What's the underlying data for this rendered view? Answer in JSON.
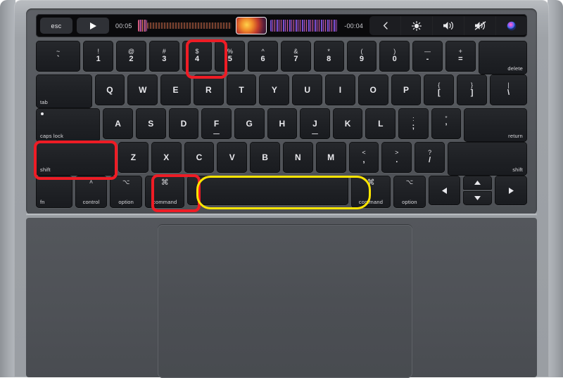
{
  "device": {
    "name": "macbook-pro-keyboard",
    "colors": {
      "highlight_red": "#ee1c25",
      "highlight_yellow": "#ffe500",
      "key_face": "#1e2024",
      "deck": "#54575c",
      "touchbar": "#0a0a0c",
      "body": "#a9adb2",
      "page_background": "#ffffff"
    }
  },
  "touchbar": {
    "esc_label": "esc",
    "play_icon": "play-icon",
    "elapsed_time": "00:05",
    "remaining_time": "-00:04",
    "waveform_left": "audio-waveform",
    "artwork_thumbnail": "album-art-thumbnail",
    "waveform_right": "audio-waveform",
    "controls": [
      {
        "icon": "chevron-left-icon",
        "label": ""
      },
      {
        "icon": "brightness-icon",
        "label": ""
      },
      {
        "icon": "volume-up-icon",
        "label": ""
      },
      {
        "icon": "volume-mute-icon",
        "label": ""
      },
      {
        "icon": "siri-icon",
        "label": ""
      }
    ]
  },
  "highlights": [
    {
      "target": "key-4",
      "color": "red",
      "style": "box"
    },
    {
      "target": "key-shift-left",
      "color": "red",
      "style": "box"
    },
    {
      "target": "key-command-left",
      "color": "red",
      "style": "box"
    },
    {
      "target": "key-space",
      "color": "yellow",
      "style": "pill"
    }
  ],
  "rows": {
    "number_row": [
      {
        "name": "grave",
        "top": "~",
        "bottom": "`",
        "width": 1.48,
        "type": "dual"
      },
      {
        "name": "1",
        "top": "!",
        "bottom": "1",
        "width": 1,
        "type": "dual"
      },
      {
        "name": "2",
        "top": "@",
        "bottom": "2",
        "width": 1,
        "type": "dual"
      },
      {
        "name": "3",
        "top": "#",
        "bottom": "3",
        "width": 1,
        "type": "dual"
      },
      {
        "name": "4",
        "top": "$",
        "bottom": "4",
        "width": 1,
        "type": "dual"
      },
      {
        "name": "5",
        "top": "%",
        "bottom": "5",
        "width": 1,
        "type": "dual"
      },
      {
        "name": "6",
        "top": "^",
        "bottom": "6",
        "width": 1,
        "type": "dual"
      },
      {
        "name": "7",
        "top": "&",
        "bottom": "7",
        "width": 1,
        "type": "dual"
      },
      {
        "name": "8",
        "top": "*",
        "bottom": "8",
        "width": 1,
        "type": "dual"
      },
      {
        "name": "9",
        "top": "(",
        "bottom": "9",
        "width": 1,
        "type": "dual"
      },
      {
        "name": "0",
        "top": ")",
        "bottom": "0",
        "width": 1,
        "type": "dual"
      },
      {
        "name": "minus",
        "top": "—",
        "bottom": "-",
        "width": 1,
        "type": "dual"
      },
      {
        "name": "equal",
        "top": "+",
        "bottom": "=",
        "width": 1,
        "type": "dual"
      },
      {
        "name": "delete",
        "label": "delete",
        "width": 1.48,
        "type": "mod-right"
      }
    ],
    "top_letter_row": [
      {
        "name": "tab",
        "label": "tab",
        "width": 1.72,
        "type": "mod-left"
      },
      {
        "name": "Q",
        "bottom": "Q",
        "width": 1,
        "type": "single"
      },
      {
        "name": "W",
        "bottom": "W",
        "width": 1,
        "type": "single"
      },
      {
        "name": "E",
        "bottom": "E",
        "width": 1,
        "type": "single"
      },
      {
        "name": "R",
        "bottom": "R",
        "width": 1,
        "type": "single"
      },
      {
        "name": "T",
        "bottom": "T",
        "width": 1,
        "type": "single"
      },
      {
        "name": "Y",
        "bottom": "Y",
        "width": 1,
        "type": "single"
      },
      {
        "name": "U",
        "bottom": "U",
        "width": 1,
        "type": "single"
      },
      {
        "name": "I",
        "bottom": "I",
        "width": 1,
        "type": "single"
      },
      {
        "name": "O",
        "bottom": "O",
        "width": 1,
        "type": "single"
      },
      {
        "name": "P",
        "bottom": "P",
        "width": 1,
        "type": "single"
      },
      {
        "name": "bracket-left",
        "top": "{",
        "bottom": "[",
        "width": 1,
        "type": "dual"
      },
      {
        "name": "bracket-right",
        "top": "}",
        "bottom": "]",
        "width": 1,
        "type": "dual"
      },
      {
        "name": "backslash",
        "top": "|",
        "bottom": "\\",
        "width": 1.24,
        "type": "dual"
      }
    ],
    "home_row": [
      {
        "name": "caps-lock",
        "label": "caps lock",
        "width": 2.0,
        "type": "caps"
      },
      {
        "name": "A",
        "bottom": "A",
        "width": 1,
        "type": "single"
      },
      {
        "name": "S",
        "bottom": "S",
        "width": 1,
        "type": "single"
      },
      {
        "name": "D",
        "bottom": "D",
        "width": 1,
        "type": "single"
      },
      {
        "name": "F",
        "bottom": "F",
        "width": 1,
        "type": "single",
        "homing": true
      },
      {
        "name": "G",
        "bottom": "G",
        "width": 1,
        "type": "single"
      },
      {
        "name": "H",
        "bottom": "H",
        "width": 1,
        "type": "single"
      },
      {
        "name": "J",
        "bottom": "J",
        "width": 1,
        "type": "single",
        "homing": true
      },
      {
        "name": "K",
        "bottom": "K",
        "width": 1,
        "type": "single"
      },
      {
        "name": "L",
        "bottom": "L",
        "width": 1,
        "type": "single"
      },
      {
        "name": "semicolon",
        "top": ":",
        "bottom": ";",
        "width": 1,
        "type": "dual"
      },
      {
        "name": "quote",
        "top": "”",
        "bottom": "’",
        "width": 1,
        "type": "dual"
      },
      {
        "name": "return",
        "label": "return",
        "width": 1.96,
        "type": "mod-right"
      }
    ],
    "bottom_letter_row": [
      {
        "name": "shift-left",
        "label": "shift",
        "width": 2.5,
        "type": "mod-left"
      },
      {
        "name": "Z",
        "bottom": "Z",
        "width": 1,
        "type": "single"
      },
      {
        "name": "X",
        "bottom": "X",
        "width": 1,
        "type": "single"
      },
      {
        "name": "C",
        "bottom": "C",
        "width": 1,
        "type": "single"
      },
      {
        "name": "V",
        "bottom": "V",
        "width": 1,
        "type": "single"
      },
      {
        "name": "B",
        "bottom": "B",
        "width": 1,
        "type": "single"
      },
      {
        "name": "N",
        "bottom": "N",
        "width": 1,
        "type": "single"
      },
      {
        "name": "M",
        "bottom": "M",
        "width": 1,
        "type": "single"
      },
      {
        "name": "comma",
        "top": "<",
        "bottom": ",",
        "width": 1,
        "type": "dual"
      },
      {
        "name": "period",
        "top": ">",
        "bottom": ".",
        "width": 1,
        "type": "dual"
      },
      {
        "name": "slash",
        "top": "?",
        "bottom": "/",
        "width": 1,
        "type": "dual"
      },
      {
        "name": "shift-right",
        "label": "shift",
        "width": 2.5,
        "type": "mod-right"
      }
    ],
    "modifier_row": [
      {
        "name": "fn",
        "label": "fn",
        "width": 1.12,
        "type": "mod-left"
      },
      {
        "name": "control-left",
        "label": "control",
        "width": 1.12,
        "type": "mod-left",
        "glyph": "˄"
      },
      {
        "name": "option-left",
        "label": "option",
        "width": 1.12,
        "type": "mod-left",
        "glyph": "⌥"
      },
      {
        "name": "command-left",
        "label": "command",
        "width": 1.38,
        "type": "mod-left",
        "glyph": "⌘"
      },
      {
        "name": "space",
        "label": "",
        "width": 5.6,
        "type": "space"
      },
      {
        "name": "command-right",
        "label": "command",
        "width": 1.38,
        "type": "mod-left",
        "glyph": "⌘"
      },
      {
        "name": "option-right",
        "label": "option",
        "width": 1.12,
        "type": "mod-left",
        "glyph": "⌥"
      },
      {
        "name": "arrow-left",
        "label": "",
        "width": 1.12,
        "type": "arrow-left"
      },
      {
        "name": "arrow-up-down",
        "label": "",
        "width": 1.12,
        "type": "arrow-updown"
      },
      {
        "name": "arrow-right",
        "label": "",
        "width": 1.12,
        "type": "arrow-right"
      }
    ]
  },
  "trackpad": {
    "name": "trackpad"
  }
}
